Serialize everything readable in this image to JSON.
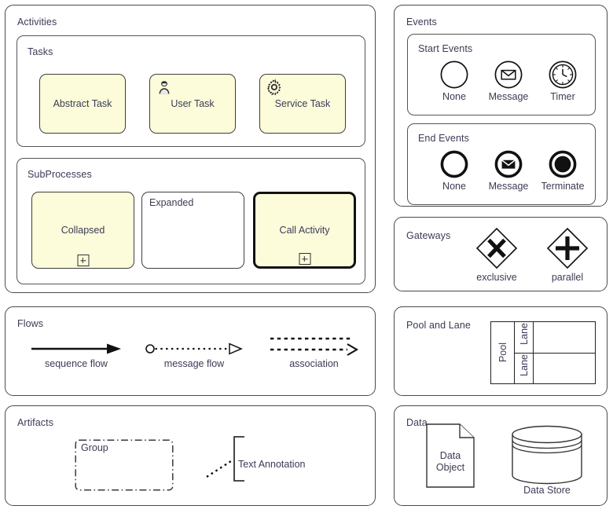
{
  "activities": {
    "title": "Activities",
    "tasks_group": {
      "title": "Tasks",
      "items": [
        {
          "label": "Abstract Task",
          "icon": "none"
        },
        {
          "label": "User Task",
          "icon": "user-icon"
        },
        {
          "label": "Service Task",
          "icon": "gear-icon"
        }
      ]
    },
    "subprocesses_group": {
      "title": "SubProcesses",
      "items": [
        {
          "label": "Collapsed",
          "style": "filled",
          "marker": "plus-marker",
          "label_position": "center"
        },
        {
          "label": "Expanded",
          "style": "plain",
          "marker": "none",
          "label_position": "top"
        },
        {
          "label": "Call Activity",
          "style": "filled-thick",
          "marker": "plus-marker",
          "label_position": "center"
        }
      ]
    }
  },
  "events": {
    "title": "Events",
    "start_events": {
      "title": "Start Events",
      "items": [
        {
          "label": "None",
          "icon": "circle-thin-icon"
        },
        {
          "label": "Message",
          "icon": "envelope-icon"
        },
        {
          "label": "Timer",
          "icon": "clock-icon"
        }
      ]
    },
    "end_events": {
      "title": "End Events",
      "items": [
        {
          "label": "None",
          "icon": "circle-thick-icon"
        },
        {
          "label": "Message",
          "icon": "envelope-filled-icon"
        },
        {
          "label": "Terminate",
          "icon": "filled-circle-icon"
        }
      ]
    }
  },
  "gateways": {
    "title": "Gateways",
    "items": [
      {
        "label": "exclusive",
        "icon": "diamond-x-icon"
      },
      {
        "label": "parallel",
        "icon": "diamond-plus-icon"
      }
    ]
  },
  "flows": {
    "title": "Flows",
    "items": [
      {
        "label": "sequence flow",
        "icon": "solid-arrow-icon"
      },
      {
        "label": "message flow",
        "icon": "dotted-open-arrow-icon"
      },
      {
        "label": "association",
        "icon": "dashed-association-icon"
      }
    ]
  },
  "pool_and_lane": {
    "title": "Pool and Lane",
    "pool_label": "Pool",
    "lane_labels": [
      "Lane",
      "Lane"
    ]
  },
  "artifacts": {
    "title": "Artifacts",
    "group_label": "Group",
    "annotation_label": "Text Annotation"
  },
  "data": {
    "title": "Data",
    "data_object_label_line1": "Data",
    "data_object_label_line2": "Object",
    "data_store_label": "Data Store"
  },
  "colors": {
    "task_fill": "#fcfbda",
    "border": "#3f3f3f",
    "text": "#3b3b55",
    "ink": "#111111"
  }
}
